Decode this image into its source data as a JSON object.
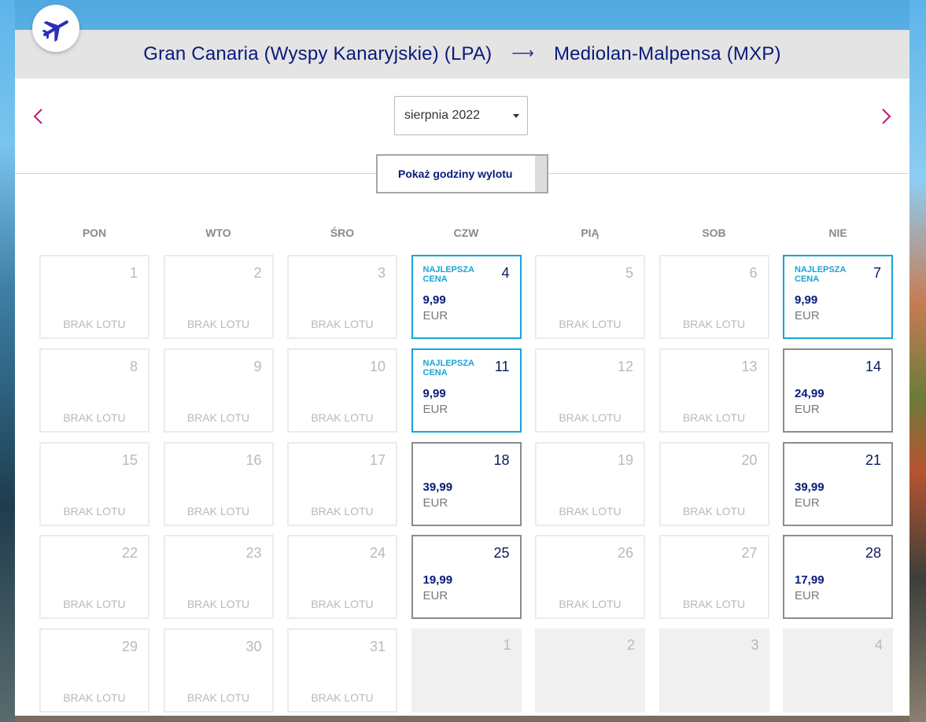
{
  "header": {
    "origin": "Gran Canaria (Wyspy Kanaryjskie) (LPA)",
    "arrow": "⟶",
    "destination": "Mediolan-Malpensa (MXP)"
  },
  "month_selector": {
    "value": "sierpnia 2022"
  },
  "show_hours_label": "Pokaż godziny wylotu",
  "weekdays": [
    "PON",
    "WTO",
    "ŚRO",
    "CZW",
    "PIĄ",
    "SOB",
    "NIE"
  ],
  "no_flight_label": "BRAK LOTU",
  "best_price_label_line1": "NAJLEPSZA",
  "best_price_label_line2": "CENA",
  "currency": "EUR",
  "days": [
    {
      "day": "1",
      "status": "none"
    },
    {
      "day": "2",
      "status": "none"
    },
    {
      "day": "3",
      "status": "none"
    },
    {
      "day": "4",
      "status": "best",
      "price": "9,99"
    },
    {
      "day": "5",
      "status": "none"
    },
    {
      "day": "6",
      "status": "none"
    },
    {
      "day": "7",
      "status": "best",
      "price": "9,99"
    },
    {
      "day": "8",
      "status": "none"
    },
    {
      "day": "9",
      "status": "none"
    },
    {
      "day": "10",
      "status": "none"
    },
    {
      "day": "11",
      "status": "best",
      "price": "9,99"
    },
    {
      "day": "12",
      "status": "none"
    },
    {
      "day": "13",
      "status": "none"
    },
    {
      "day": "14",
      "status": "avail",
      "price": "24,99"
    },
    {
      "day": "15",
      "status": "none"
    },
    {
      "day": "16",
      "status": "none"
    },
    {
      "day": "17",
      "status": "none"
    },
    {
      "day": "18",
      "status": "avail",
      "price": "39,99"
    },
    {
      "day": "19",
      "status": "none"
    },
    {
      "day": "20",
      "status": "none"
    },
    {
      "day": "21",
      "status": "avail",
      "price": "39,99"
    },
    {
      "day": "22",
      "status": "none"
    },
    {
      "day": "23",
      "status": "none"
    },
    {
      "day": "24",
      "status": "none"
    },
    {
      "day": "25",
      "status": "avail",
      "price": "19,99"
    },
    {
      "day": "26",
      "status": "none"
    },
    {
      "day": "27",
      "status": "none"
    },
    {
      "day": "28",
      "status": "avail",
      "price": "17,99"
    },
    {
      "day": "29",
      "status": "none"
    },
    {
      "day": "30",
      "status": "none"
    },
    {
      "day": "31",
      "status": "none"
    },
    {
      "day": "1",
      "status": "other"
    },
    {
      "day": "2",
      "status": "other"
    },
    {
      "day": "3",
      "status": "other"
    },
    {
      "day": "4",
      "status": "other"
    }
  ],
  "icons": {
    "logo": "airplane-icon",
    "prev": "chevron-left-icon",
    "next": "chevron-right-icon",
    "select": "caret-down-icon"
  },
  "colors": {
    "brand_navy": "#0a1a7a",
    "best_price_blue": "#17a5d6",
    "nav_magenta": "#c2187a"
  }
}
